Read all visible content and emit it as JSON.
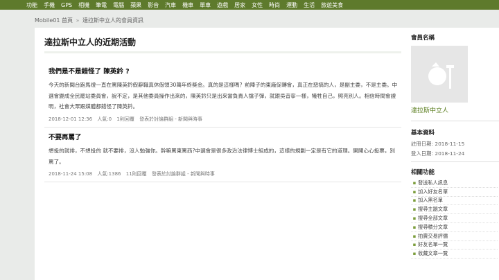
{
  "topnav": [
    "功能",
    "手機",
    "GPS",
    "相機",
    "筆電",
    "電腦",
    "蘋果",
    "影音",
    "汽車",
    "機車",
    "單車",
    "遊戲",
    "居家",
    "女性",
    "時尚",
    "運動",
    "生活",
    "旅遊美食"
  ],
  "breadcrumb": {
    "home": "Mobile01 首頁",
    "sep": "»",
    "current": "達拉斯中立人的會員資訊"
  },
  "main": {
    "title": "達拉斯中立人的近期活動",
    "posts": [
      {
        "title": "我們是不是錯怪了 陳英鈐 ?",
        "body": "今天的新聞台跑馬燈一直在罵陳英鈐假辭職真休假領30萬年終獎金。真的是這樣嗎？前陣子的東廠促轉會，真正在惡搞的人，是副主委，不是主委。中選會變成全民罷站委員會，說不定，是其他委員操作出來的，陳英鈐只是出來當負責人擋子彈，就跟吳音寧一樣，犧牲自己，照亮別人。相信時間會證明，社會大眾跟媒體都錯怪了陳英鈐。",
        "date": "2018-12-01 12:36",
        "views": "人氣:0",
        "replies": "1則回覆",
        "forum": "發表於討論群組 - 新聞與時事"
      },
      {
        "title": "不要再罵了",
        "body": "想投的就排，不想投的 就不要排，沒人勉強你。幹嘛罵東罵西?中選會是很多政治法律博士組成的，這樣的規劃一定是有它的道理。開開心心投票，別罵了。",
        "date": "2018-11-24 15:08",
        "views": "人氣:1386",
        "replies": "11則回覆",
        "forum": "發表於討論群組 - 新聞與時事"
      }
    ]
  },
  "sidebar": {
    "member_heading": "會員名稱",
    "username": "達拉斯中立人",
    "info_heading": "基本資料",
    "register_date": "註冊日期: 2018-11-15",
    "login_date": "登入日期: 2018-11-24",
    "func_heading": "相關功能",
    "funcs": [
      "發送私人訊息",
      "加入好友名單",
      "加入黑名單",
      "搜尋主題文章",
      "搜尋全部文章",
      "搜尋積分文章",
      "拍賣交易評價",
      "好友名單一覽",
      "收藏文章一覽"
    ]
  },
  "colors": {
    "nav": "#5e7a2c",
    "link": "#5a7d1e",
    "bullet": "#7a9c3a"
  }
}
